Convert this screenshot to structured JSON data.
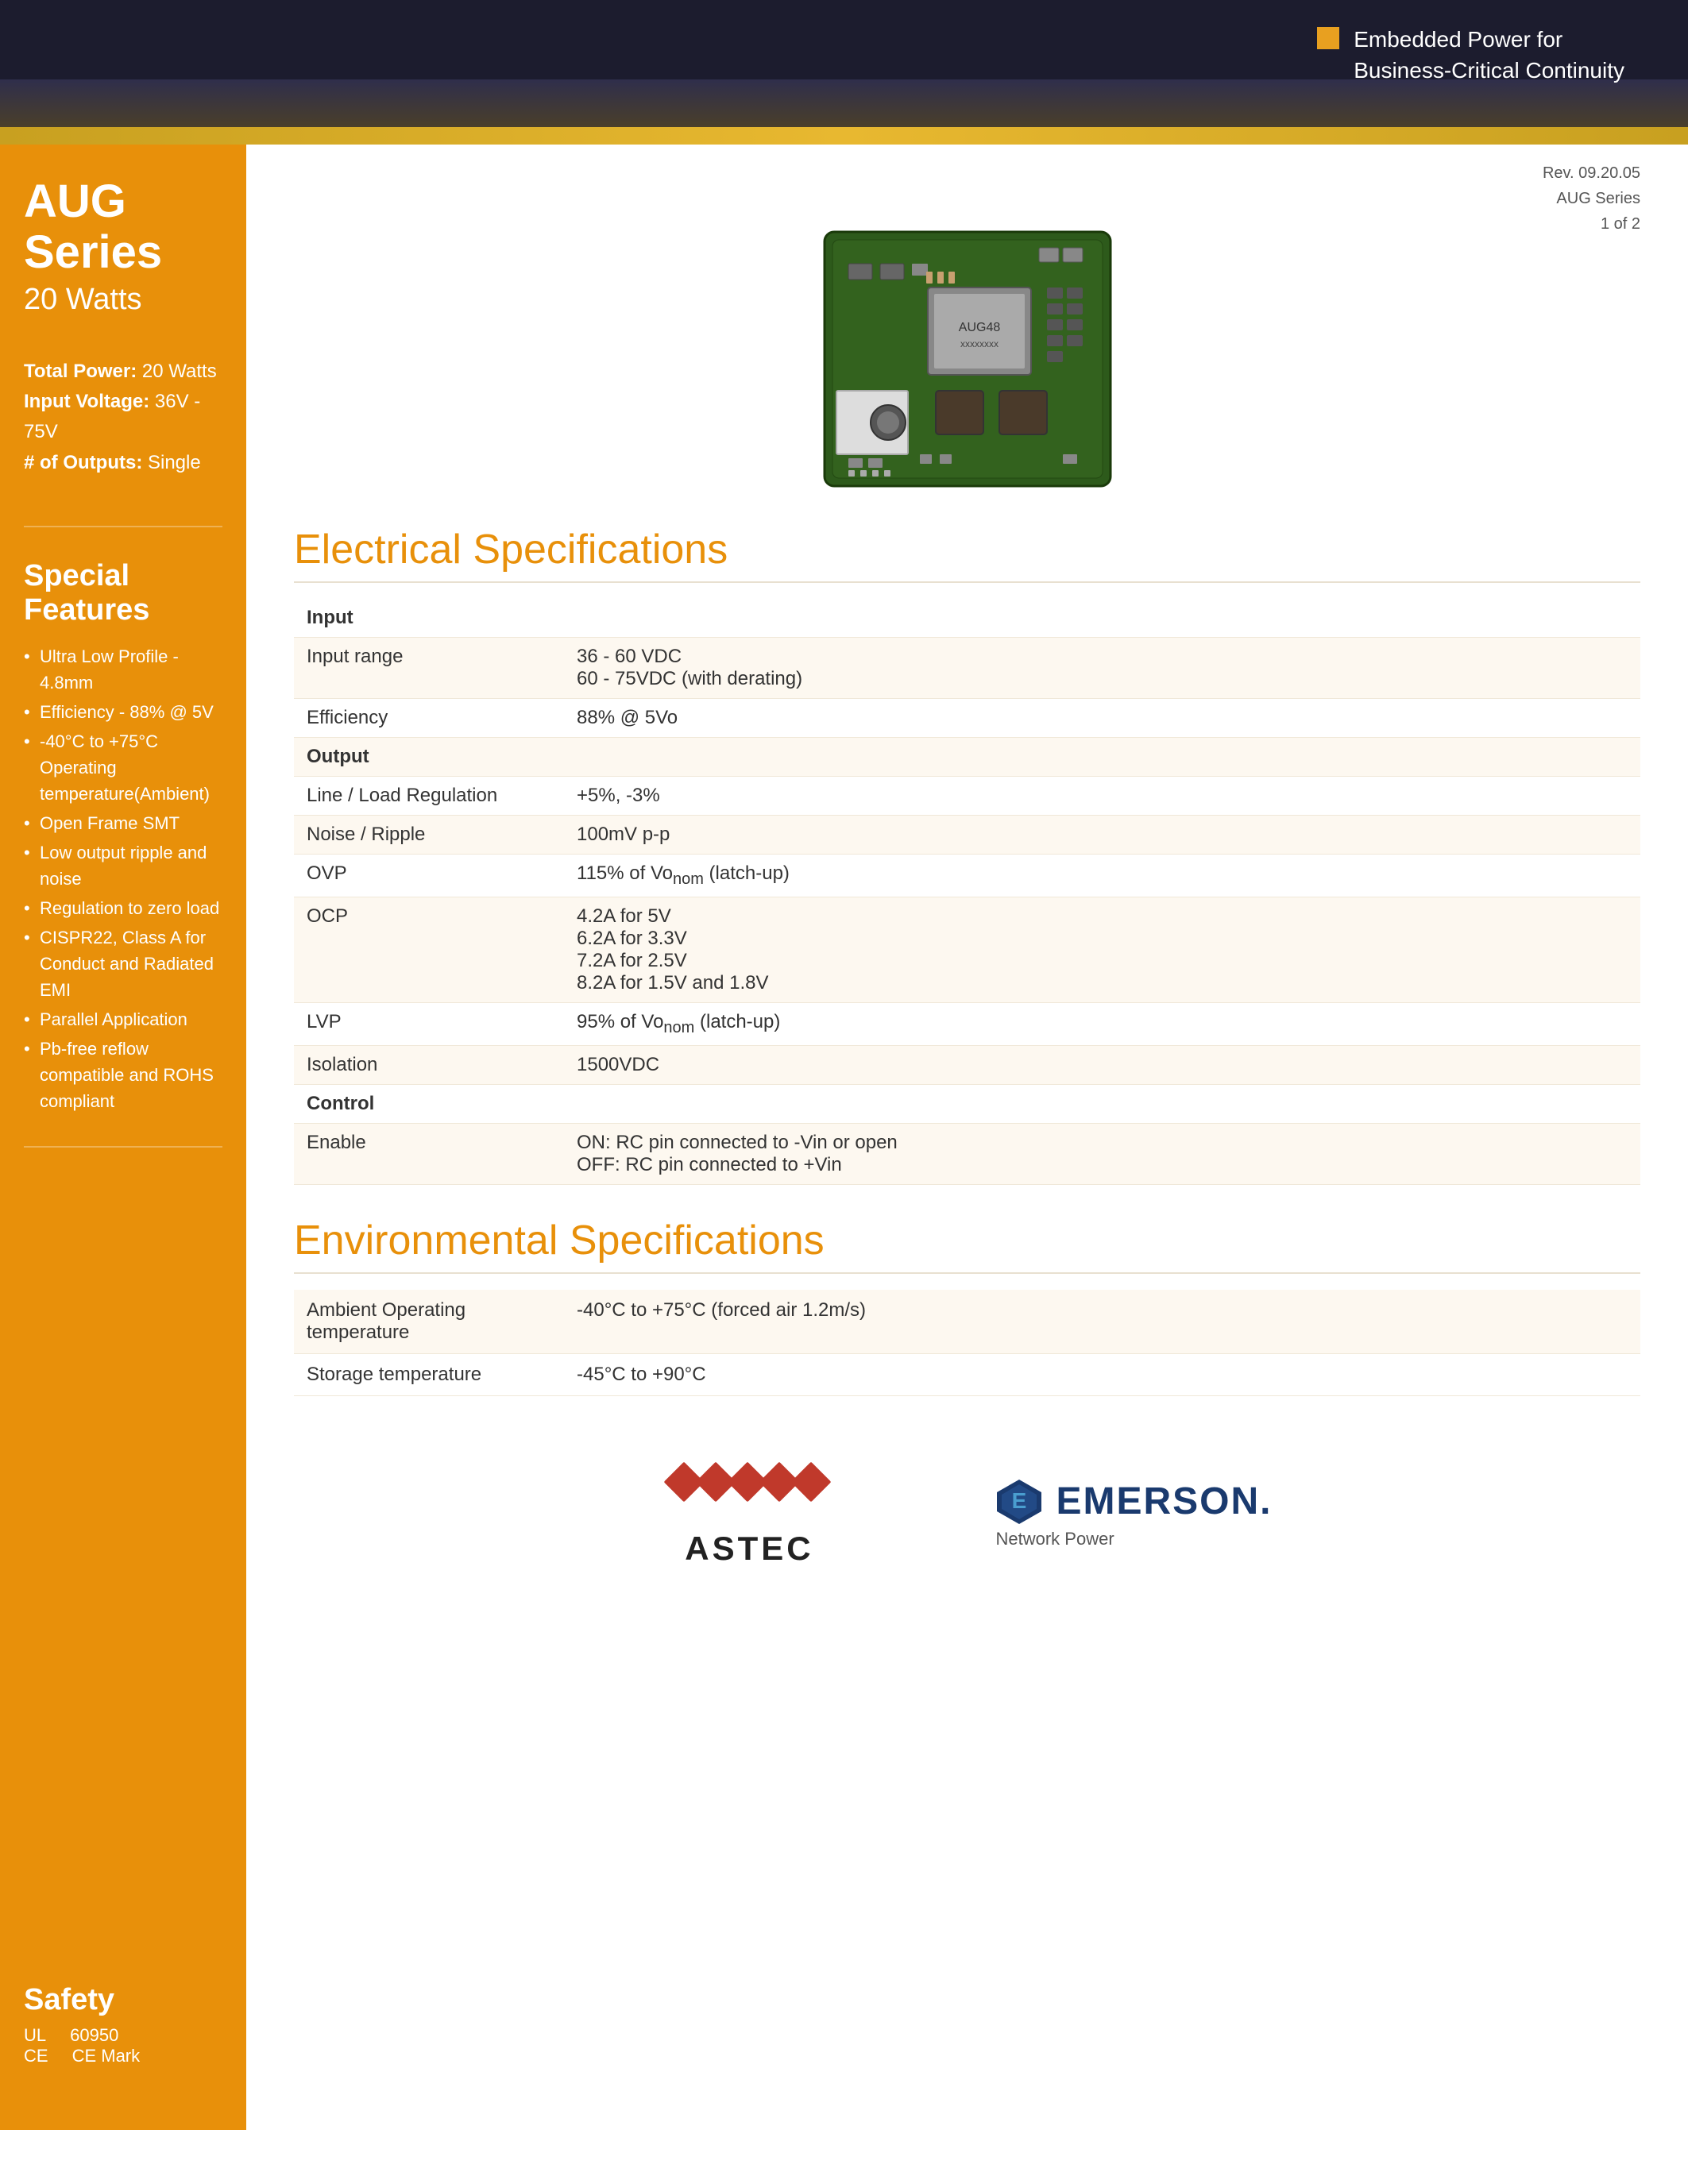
{
  "header": {
    "tagline_line1": "Embedded Power for",
    "tagline_line2": "Business-Critical Continuity"
  },
  "rev_info": {
    "rev": "Rev. 09.20.05",
    "series": "AUG Series",
    "page": "1 of 2"
  },
  "sidebar": {
    "series_title": "AUG Series",
    "watts": "20 Watts",
    "total_power_label": "Total Power:",
    "total_power_value": "20 Watts",
    "input_voltage_label": "Input Voltage:",
    "input_voltage_value": "36V - 75V",
    "outputs_label": "# of Outputs:",
    "outputs_value": "Single",
    "special_features_title": "Special Features",
    "features": [
      "Ultra Low Profile - 4.8mm",
      "Efficiency - 88% @ 5V",
      "-40°C to +75°C Operating temperature(Ambient)",
      "Open Frame SMT",
      "Low output ripple and noise",
      "Regulation to zero load",
      "CISPR22, Class A for Conduct and Radiated EMI",
      "Parallel Application",
      "Pb-free reflow compatible and ROHS compliant"
    ],
    "safety_title": "Safety",
    "safety_ul_label": "UL",
    "safety_ul_value": "60950",
    "safety_ce_label": "CE",
    "safety_ce_value": "CE Mark"
  },
  "electrical_specs": {
    "section_title": "Electrical Specifications",
    "input_header": "Input",
    "input_range_label": "Input range",
    "input_range_value1": "36 - 60 VDC",
    "input_range_value2": "60 - 75VDC (with derating)",
    "efficiency_label": "Efficiency",
    "efficiency_value": "88% @ 5Vo",
    "output_header": "Output",
    "line_load_label": "Line / Load Regulation",
    "line_load_value": "+5%, -3%",
    "noise_ripple_label": "Noise / Ripple",
    "noise_ripple_value": "100mV p-p",
    "ovp_label": "OVP",
    "ovp_value": "115% of Vo",
    "ovp_suffix": "nom",
    "ovp_end": " (latch-up)",
    "ocp_label": "OCP",
    "ocp_value1": "4.2A for 5V",
    "ocp_value2": "6.2A for 3.3V",
    "ocp_value3": "7.2A for 2.5V",
    "ocp_value4": "8.2A for 1.5V and 1.8V",
    "lvp_label": "LVP",
    "lvp_value": "95% of Vo",
    "lvp_suffix": "nom",
    "lvp_end": " (latch-up)",
    "isolation_label": "Isolation",
    "isolation_value": "1500VDC",
    "control_header": "Control",
    "enable_label": "Enable",
    "enable_value1": "ON: RC pin connected to -Vin or open",
    "enable_value2": "OFF: RC pin connected to +Vin"
  },
  "environmental_specs": {
    "section_title": "Environmental Specifications",
    "ambient_temp_label": "Ambient Operating temperature",
    "ambient_temp_value": "-40°C to +75°C (forced air 1.2m/s)",
    "storage_temp_label": "Storage temperature",
    "storage_temp_value": "-45°C to +90°C"
  },
  "logos": {
    "astec_text": "ASTEC",
    "emerson_name": "EMERSON.",
    "emerson_subtitle": "Network Power"
  }
}
